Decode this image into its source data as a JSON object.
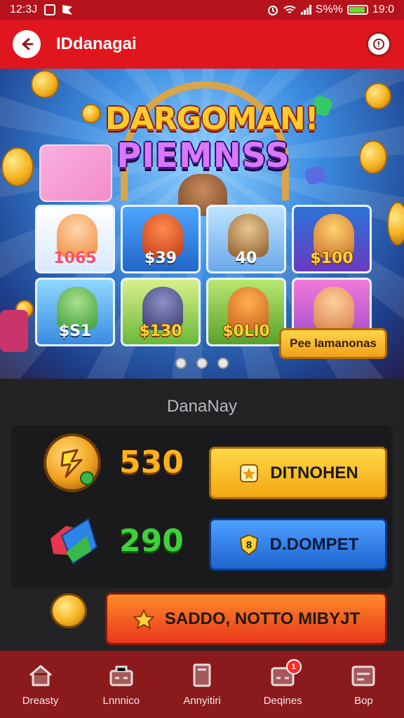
{
  "status_bar": {
    "time": "12:3J",
    "battery_text": "S%%",
    "clock_right": "19:0"
  },
  "app_bar": {
    "title": "IDdanagai",
    "back_icon": "back-arrow-icon",
    "info_icon": "info-icon"
  },
  "banner": {
    "logo_line1": "DARGOMAN!",
    "logo_line2": "PIEMNSS",
    "cards": [
      {
        "price": "1065"
      },
      {
        "price": "$39"
      },
      {
        "price": "40"
      },
      {
        "price": "$100"
      },
      {
        "price": "$S1"
      },
      {
        "price": "$130"
      },
      {
        "price": "$0Ll0"
      },
      {
        "price": ""
      }
    ],
    "promo_button": "Pee lamanonas",
    "page_dots": 3,
    "colors": {
      "gold": "#ffd23a",
      "sky": "#3a8be0"
    }
  },
  "wallet": {
    "title": "DanaNay",
    "coins_balance": "530",
    "gems_balance": "290",
    "deposit_button": "DITNOHEN",
    "withdraw_button": "D.DOMPET",
    "cta_button": "SADDO, NOTTO MIBYJT",
    "colors": {
      "coins_text": "#ffb21e",
      "gems_text": "#3fd13a",
      "deposit_bg": "#ffc21a",
      "withdraw_bg": "#2f7fe6",
      "cta_bg": "#f0531a"
    }
  },
  "bottom_nav": {
    "items": [
      {
        "label": "Dreasty",
        "icon": "home-icon"
      },
      {
        "label": "Lnnnico",
        "icon": "shop-icon"
      },
      {
        "label": "Annyitiri",
        "icon": "document-icon"
      },
      {
        "label": "Deqines",
        "icon": "inbox-icon",
        "badge": "1"
      },
      {
        "label": "Bop",
        "icon": "ticket-icon"
      }
    ],
    "colors": {
      "bg": "#8a1a1c"
    }
  }
}
